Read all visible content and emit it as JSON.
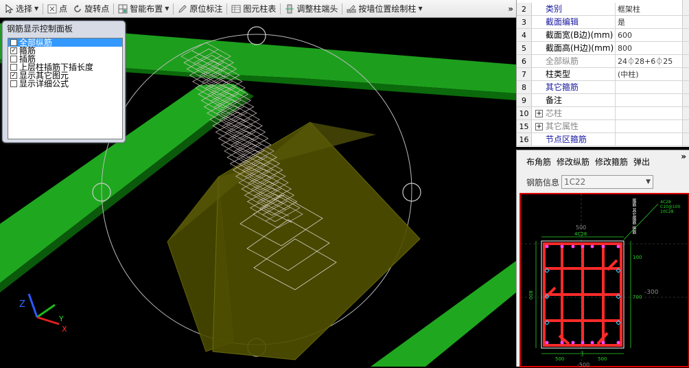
{
  "toolbar": {
    "select": "选择",
    "point": "点",
    "rotate_point": "旋转点",
    "smart_layout": "智能布置",
    "original_label": "原位标注",
    "element_column_table": "图元柱表",
    "adjust_column_head": "调整柱端头",
    "draw_by_wall": "按墙位置绘制柱",
    "more": "»"
  },
  "control_panel": {
    "title": "钢筋显示控制面板",
    "items": [
      {
        "label": "全部纵筋",
        "checked": false,
        "selected": true
      },
      {
        "label": "箍筋",
        "checked": true,
        "selected": false
      },
      {
        "label": "插筋",
        "checked": false,
        "selected": false
      },
      {
        "label": "上层柱插筋下插长度",
        "checked": false,
        "selected": false
      },
      {
        "label": "显示其它图元",
        "checked": true,
        "selected": false
      },
      {
        "label": "显示详细公式",
        "checked": false,
        "selected": false
      }
    ]
  },
  "properties": {
    "rows": [
      {
        "num": "2",
        "name": "类别",
        "value": "框架柱",
        "name_color": "#1a1aa0",
        "expand": false
      },
      {
        "num": "3",
        "name": "截面编辑",
        "value": "是",
        "name_color": "#1a1aa0",
        "expand": false
      },
      {
        "num": "4",
        "name": "截面宽(B边)(mm)",
        "value": "600",
        "name_color": "#000000",
        "expand": false
      },
      {
        "num": "5",
        "name": "截面高(H边)(mm)",
        "value": "800",
        "name_color": "#000000",
        "expand": false
      },
      {
        "num": "6",
        "name": "全部纵筋",
        "value": "24⏀28+6⏀25",
        "name_color": "#888888",
        "expand": false
      },
      {
        "num": "7",
        "name": "柱类型",
        "value": "(中柱)",
        "name_color": "#000000",
        "expand": false
      },
      {
        "num": "8",
        "name": "其它箍筋",
        "value": "",
        "name_color": "#1a1aa0",
        "expand": false
      },
      {
        "num": "9",
        "name": "备注",
        "value": "",
        "name_color": "#000000",
        "expand": false
      },
      {
        "num": "10",
        "name": "芯柱",
        "value": "",
        "name_color": "#888888",
        "expand": true
      },
      {
        "num": "15",
        "name": "其它属性",
        "value": "",
        "name_color": "#888888",
        "expand": true
      },
      {
        "num": "16",
        "name": "节点区箍筋",
        "value": "",
        "name_color": "#1a1aa0",
        "expand": false
      }
    ]
  },
  "rebar_editor": {
    "tabs": [
      "布角筋",
      "修改纵筋",
      "修改箍筋",
      "弹出"
    ],
    "info_label": "钢筋信息",
    "info_value": "1C22",
    "more": "»"
  },
  "section": {
    "top_dim": "500",
    "top_rebar": "4C28",
    "bottom_dims": [
      "500",
      "500"
    ],
    "bottom_total": "-500",
    "right_dims": [
      "100",
      "700"
    ],
    "right_total": "-300",
    "left_dim": "800",
    "notes": [
      "4C28",
      "C10@100",
      "10C28"
    ],
    "vertical_notes": [
      "箍筋",
      "其它箍筋",
      "纵筋"
    ]
  },
  "axes": {
    "x": "X",
    "y": "Y",
    "z": "Z"
  },
  "colors": {
    "beam_green": "#1fa81f",
    "column_olive": "#4a4a00",
    "rebar_red": "#ff2a2a",
    "panel_bg": "#d6dbe6",
    "link_blue": "#1a1aa0"
  }
}
